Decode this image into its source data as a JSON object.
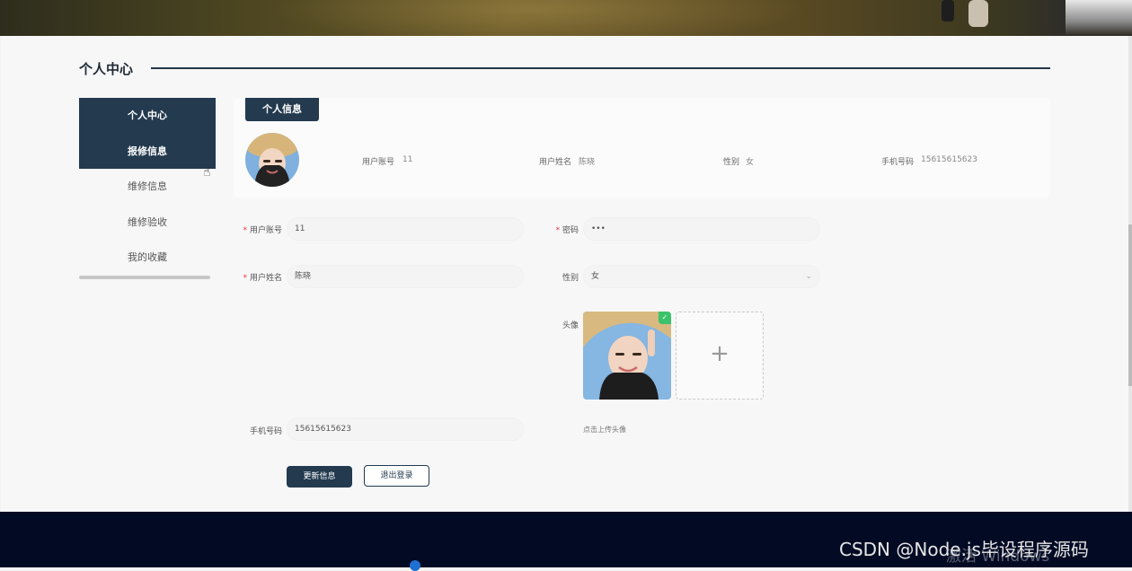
{
  "section": {
    "title": "个人中心"
  },
  "sidebar": {
    "items": [
      {
        "label": "个人中心",
        "active": true
      },
      {
        "label": "报修信息",
        "active": true
      },
      {
        "label": "维修信息",
        "active": false
      },
      {
        "label": "维修验收",
        "active": false
      },
      {
        "label": "我的收藏",
        "active": false
      }
    ]
  },
  "profile_card": {
    "tab_label": "个人信息",
    "account_label": "用户账号",
    "account_value": "11",
    "name_label": "用户姓名",
    "name_value": "陈晓",
    "gender_label": "性别",
    "gender_value": "女",
    "phone_label": "手机号码",
    "phone_value": "15615615623"
  },
  "form": {
    "required_mark": "*",
    "account_label": "用户账号",
    "account_value": "11",
    "password_label": "密码",
    "password_value": "•••",
    "name_label": "用户姓名",
    "name_value": "陈晓",
    "gender_label": "性别",
    "gender_value": "女",
    "avatar_label": "头像",
    "upload_plus": "+",
    "upload_tip": "点击上传头像",
    "phone_label": "手机号码",
    "phone_value": "15615615623",
    "update_button": "更新信息",
    "logout_button": "退出登录"
  },
  "overlay": {
    "csdn": "CSDN @Node.js毕设程序源码",
    "activate_windows": "激活 Windows"
  },
  "colors": {
    "primary": "#233a4f",
    "footer": "#030b24",
    "success": "#3cc26a"
  }
}
